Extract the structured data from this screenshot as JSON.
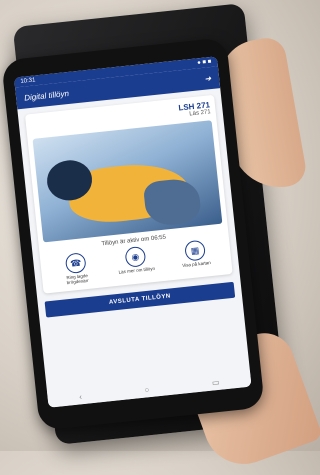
{
  "status_bar": {
    "left": "10:31",
    "right": "● ■ ■"
  },
  "header": {
    "title": "Digital tillöyn",
    "back_icon": "arrow-back-icon"
  },
  "card": {
    "title": "LSH 271",
    "subtitle": "Läs 271"
  },
  "validity_text": "Tillöyn är aktiv om 06:55",
  "actions": [
    {
      "label": "Ring lagde brögdenärr",
      "icon": "phone-icon"
    },
    {
      "label": "Läs mer om tillöyn",
      "icon": "badge-icon"
    },
    {
      "label": "Visa på kartan",
      "icon": "map-icon"
    }
  ],
  "primary_button": "AVSLUTA TILLÖYN",
  "nav_icons": [
    "back-icon",
    "home-icon",
    "recent-icon"
  ]
}
